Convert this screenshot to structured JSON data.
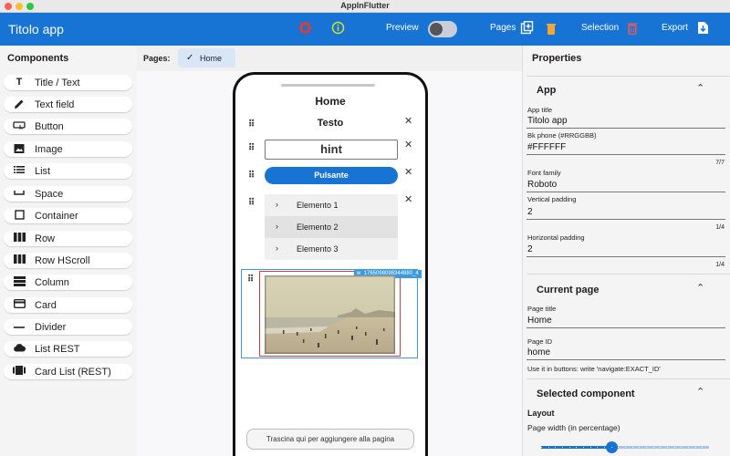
{
  "window": {
    "title": "AppInFlutter"
  },
  "appbar": {
    "title": "Titolo app",
    "preview_label": "Preview",
    "pages_label": "Pages",
    "selection_label": "Selection",
    "export_label": "Export",
    "colors": {
      "bar": "#1773d4",
      "settings_icon": "#e8392c",
      "info_icon": "#d4e22a",
      "page_icon": "#f2a53a",
      "delete_icon": "#e85c5c"
    }
  },
  "components": {
    "title": "Components",
    "items": [
      {
        "label": "Title / Text",
        "icon": "text-icon"
      },
      {
        "label": "Text field",
        "icon": "pencil-icon"
      },
      {
        "label": "Button",
        "icon": "button-icon"
      },
      {
        "label": "Image",
        "icon": "image-icon"
      },
      {
        "label": "List",
        "icon": "list-icon"
      },
      {
        "label": "Space",
        "icon": "space-icon"
      },
      {
        "label": "Container",
        "icon": "container-icon"
      },
      {
        "label": "Row",
        "icon": "row-icon"
      },
      {
        "label": "Row HScroll",
        "icon": "row-hscroll-icon"
      },
      {
        "label": "Column",
        "icon": "column-icon"
      },
      {
        "label": "Card",
        "icon": "card-icon"
      },
      {
        "label": "Divider",
        "icon": "divider-icon"
      },
      {
        "label": "List REST",
        "icon": "cloud-icon"
      },
      {
        "label": "Card List (REST)",
        "icon": "card-list-icon"
      }
    ]
  },
  "pages": {
    "label": "Pages:",
    "current": "Home"
  },
  "phone": {
    "page_title": "Home",
    "text_widget": "Testo",
    "hint_widget": "hint",
    "button_widget": "Pulsante",
    "list_items": [
      "Elemento 1",
      "Elemento 2",
      "Elemento 3"
    ],
    "image_badge": "w_1765098098344880_4",
    "dropzone": "Trascina qui per aggiungere alla pagina"
  },
  "properties": {
    "title": "Properties",
    "app_section": "App",
    "app_title_label": "App title",
    "app_title_value": "Titolo app",
    "bk_label": "Bk phone (#RRGGBB)",
    "bk_value": "#FFFFFF",
    "bk_counter": "7/7",
    "font_label": "Font family",
    "font_value": "Roboto",
    "vpad_label": "Vertical padding",
    "vpad_value": "2",
    "vpad_counter": "1/4",
    "hpad_label": "Horizontal padding",
    "hpad_value": "2",
    "hpad_counter": "1/4",
    "page_section": "Current page",
    "page_title_label": "Page title",
    "page_title_value": "Home",
    "page_id_label": "Page ID",
    "page_id_value": "home",
    "page_note": "Use it in buttons: write 'navigate:EXACT_ID'",
    "component_section": "Selected component",
    "layout_label": "Layout",
    "width_label": "Page width (in percentage)",
    "width_slider_fraction": 0.42
  }
}
